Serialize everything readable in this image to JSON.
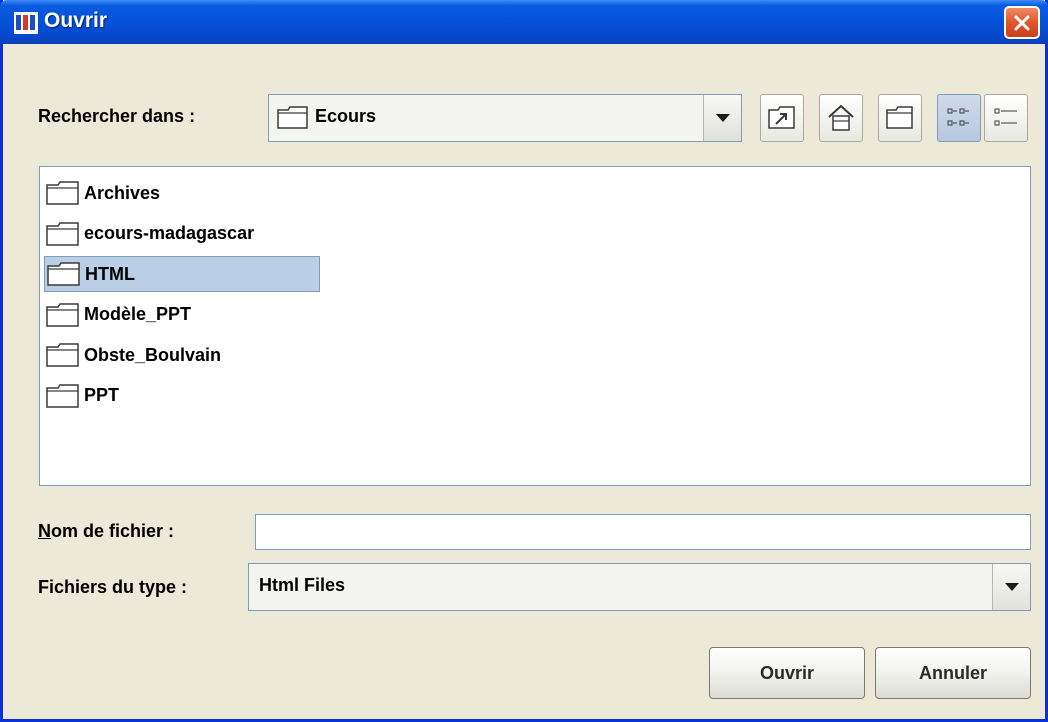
{
  "window": {
    "title": "Ouvrir"
  },
  "look_in": {
    "label": "Rechercher dans :",
    "value": "Ecours"
  },
  "toolbar": {
    "buttons": [
      {
        "icon": "up-folder-icon"
      },
      {
        "icon": "home-icon"
      },
      {
        "icon": "new-folder-icon"
      },
      {
        "icon": "list-view-icon",
        "pressed": true
      },
      {
        "icon": "details-view-icon"
      }
    ]
  },
  "files": [
    {
      "name": "Archives",
      "icon": "folder-icon",
      "selected": false
    },
    {
      "name": "ecours-madagascar",
      "icon": "folder-icon",
      "selected": false
    },
    {
      "name": "HTML",
      "icon": "folder-icon",
      "selected": true
    },
    {
      "name": "Modèle_PPT",
      "icon": "folder-icon",
      "selected": false
    },
    {
      "name": "Obste_Boulvain",
      "icon": "folder-icon",
      "selected": false
    },
    {
      "name": "PPT",
      "icon": "folder-icon",
      "selected": false
    }
  ],
  "filename": {
    "label_mnemonic": "N",
    "label_rest": "om de fichier :",
    "value": ""
  },
  "filetype": {
    "label": "Fichiers du type :",
    "value": "Html Files"
  },
  "buttons": {
    "open": "Ouvrir",
    "cancel": "Annuler"
  },
  "colors": {
    "titlebar": "#0654dc",
    "dialog_bg": "#ece9d8",
    "selection": "#b8cfe5",
    "close_button": "#e25a2f"
  }
}
